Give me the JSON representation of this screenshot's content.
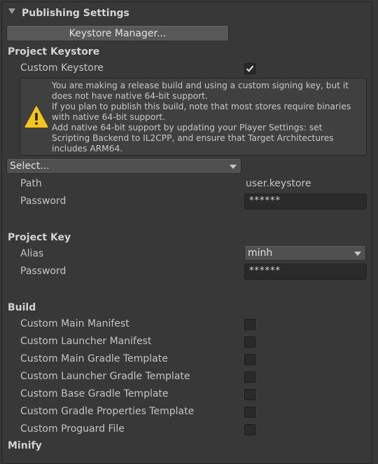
{
  "header": {
    "title": "Publishing Settings"
  },
  "keystore_manager": {
    "label": "Keystore Manager..."
  },
  "project_keystore": {
    "heading": "Project Keystore",
    "custom_keystore_label": "Custom Keystore",
    "custom_keystore_checked": true,
    "warning_lines": [
      "You are making a release build and using a custom signing key, but it",
      "does not have native 64-bit support.",
      "If you plan to publish this build, note that most stores require binaries",
      "with native 64-bit support.",
      "Add native 64-bit support by updating your Player Settings: set",
      "Scripting Backend to IL2CPP, and ensure that Target Architectures",
      "includes ARM64."
    ],
    "select_label": "Select...",
    "path_label": "Path",
    "path_value": "user.keystore",
    "password_label": "Password",
    "password_value": "******"
  },
  "project_key": {
    "heading": "Project Key",
    "alias_label": "Alias",
    "alias_value": "minh",
    "password_label": "Password",
    "password_value": "******"
  },
  "build": {
    "heading": "Build",
    "options": [
      {
        "label": "Custom Main Manifest",
        "checked": false
      },
      {
        "label": "Custom Launcher Manifest",
        "checked": false
      },
      {
        "label": "Custom Main Gradle Template",
        "checked": false
      },
      {
        "label": "Custom Launcher Gradle Template",
        "checked": false
      },
      {
        "label": "Custom Base Gradle Template",
        "checked": false
      },
      {
        "label": "Custom Gradle Properties Template",
        "checked": false
      },
      {
        "label": "Custom Proguard File",
        "checked": false
      }
    ]
  },
  "minify": {
    "heading": "Minify"
  },
  "icons": {
    "foldout": "triangle-down-icon",
    "warning": "warning-icon",
    "check": "checkmark-icon",
    "dropdown": "chevron-down-icon"
  },
  "colors": {
    "background": "#383838",
    "warning_yellow": "#f5c518",
    "field_bg": "#2a2a2a"
  }
}
